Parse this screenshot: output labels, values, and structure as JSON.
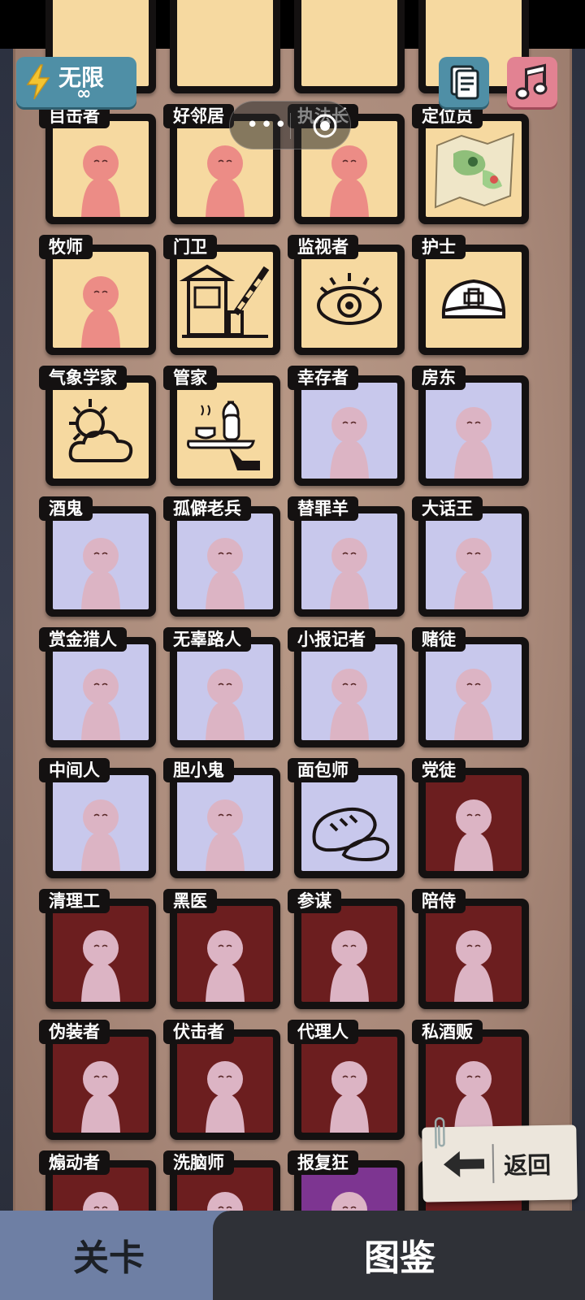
{
  "top_bar": {
    "energy_label": "无限",
    "energy_value": "∞",
    "doc_icon": "document-icon",
    "music_icon": "music-note-icon",
    "miniprogram_menu_icon": "more-dots-icon",
    "miniprogram_close_icon": "close-target-icon"
  },
  "top_row_partial": [
    {
      "bg": "cream"
    },
    {
      "bg": "cream"
    },
    {
      "bg": "cream"
    },
    {
      "bg": "cream"
    }
  ],
  "cards": [
    {
      "label": "目击者",
      "bg": "cream",
      "icon": "witness-window-figure"
    },
    {
      "label": "好邻居",
      "bg": "cream",
      "icon": "neighbor-jars-figure"
    },
    {
      "label": "执法长",
      "bg": "cream",
      "icon": "chief-swords-figure"
    },
    {
      "label": "定位员",
      "bg": "cream",
      "icon": "map-pin-icon"
    },
    {
      "label": "牧师",
      "bg": "cream",
      "icon": "priest-cross-figure"
    },
    {
      "label": "门卫",
      "bg": "cream",
      "icon": "gatehouse-barrier-icon"
    },
    {
      "label": "监视者",
      "bg": "cream",
      "icon": "eye-icon"
    },
    {
      "label": "护士",
      "bg": "cream",
      "icon": "nurse-cap-icon"
    },
    {
      "label": "气象学家",
      "bg": "cream",
      "icon": "sun-cloud-icon"
    },
    {
      "label": "管家",
      "bg": "cream",
      "icon": "tea-tray-icon"
    },
    {
      "label": "幸存者",
      "bg": "lav",
      "icon": "survivor-figure"
    },
    {
      "label": "房东",
      "bg": "lav",
      "icon": "landlord-keys-figure"
    },
    {
      "label": "酒鬼",
      "bg": "lav",
      "icon": "drunkard-portrait"
    },
    {
      "label": "孤僻老兵",
      "bg": "lav",
      "icon": "veteran-rifle-figure"
    },
    {
      "label": "替罪羊",
      "bg": "lav",
      "icon": "scapegoat-ram-figure"
    },
    {
      "label": "大话王",
      "bg": "lav",
      "icon": "liar-portrait"
    },
    {
      "label": "赏金猎人",
      "bg": "lav",
      "icon": "bounty-hunter-portrait"
    },
    {
      "label": "无辜路人",
      "bg": "lav",
      "icon": "bystander-guns-figure"
    },
    {
      "label": "小报记者",
      "bg": "lav",
      "icon": "reporter-portrait"
    },
    {
      "label": "赌徒",
      "bg": "lav",
      "icon": "gambler-coins-figure"
    },
    {
      "label": "中间人",
      "bg": "lav",
      "icon": "middleman-portrait"
    },
    {
      "label": "胆小鬼",
      "bg": "lav",
      "icon": "coward-portrait"
    },
    {
      "label": "面包师",
      "bg": "lav",
      "icon": "bread-icon"
    },
    {
      "label": "党徒",
      "bg": "red",
      "icon": "partisan-portrait"
    },
    {
      "label": "清理工",
      "bg": "red",
      "icon": "cleaner-papers-figure"
    },
    {
      "label": "黑医",
      "bg": "red",
      "icon": "black-doctor-portrait"
    },
    {
      "label": "参谋",
      "bg": "red",
      "icon": "advisor-bulb-figure"
    },
    {
      "label": "陪侍",
      "bg": "red",
      "icon": "attendant-portrait"
    },
    {
      "label": "伪装者",
      "bg": "red",
      "icon": "disguiser-mask-figure"
    },
    {
      "label": "伏击者",
      "bg": "red",
      "icon": "ambusher-door-figure"
    },
    {
      "label": "代理人",
      "bg": "red",
      "icon": "agent-portrait"
    },
    {
      "label": "私酒贩",
      "bg": "red",
      "icon": "bootlegger-bottles-figure"
    },
    {
      "label": "煽动者",
      "bg": "red",
      "icon": "agitator-figure"
    },
    {
      "label": "洗脑师",
      "bg": "red",
      "icon": "brainwasher-chain-figure"
    },
    {
      "label": "报复狂",
      "bg": "purple",
      "icon": "avenger-figure"
    },
    {
      "label": "",
      "bg": "red",
      "icon": "hidden-card"
    }
  ],
  "back_button": {
    "label": "返回",
    "icon": "left-arrow-icon",
    "clip_icon": "paperclip-icon"
  },
  "tabs": {
    "levels": "关卡",
    "codex": "图鉴",
    "active": "codex"
  },
  "colors": {
    "cream": "#f6d9a0",
    "lavender": "#c8c8ec",
    "crimson": "#6c1e1f",
    "purple": "#7d3591",
    "figure_pink": "#ec8c86",
    "figure_lav": "#dcb4c4",
    "accent_teal": "#4f8fa6"
  }
}
